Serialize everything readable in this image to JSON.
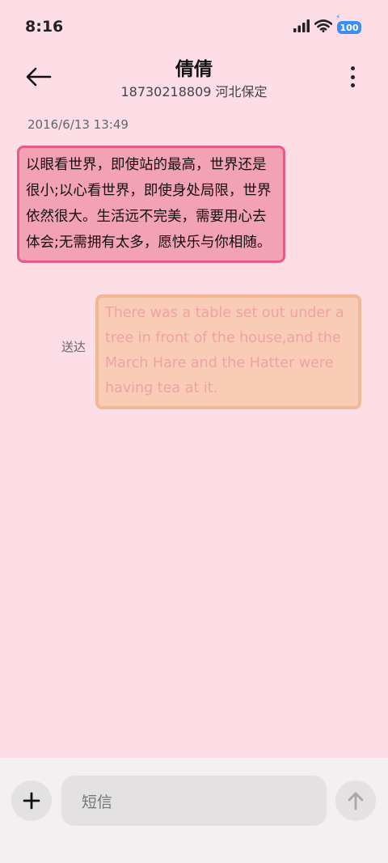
{
  "status_bar": {
    "time": "8:16",
    "battery": "100",
    "icons": [
      "signal-icon",
      "wifi-icon",
      "battery-icon"
    ]
  },
  "header": {
    "name": "倩倩",
    "subtitle": "18730218809 河北保定",
    "back_icon": "back-arrow-icon",
    "more_icon": "more-vertical-icon"
  },
  "conversation": {
    "timestamp": "2016/6/13 13:49",
    "messages": [
      {
        "direction": "incoming",
        "text": "以眼看世界，即使站的最高，世界还是很小;以心看世界，即使身处局限，世界依然很大。生活远不完美，需要用心去体会;无需拥有太多，愿快乐与你相随。"
      },
      {
        "direction": "outgoing",
        "status": "送达",
        "text": "There was a table set out under a tree in front of the house,and the March Hare and the Hatter were having tea at it."
      }
    ]
  },
  "composer": {
    "placeholder": "短信",
    "add_icon": "plus-icon",
    "send_icon": "send-arrow-icon"
  },
  "colors": {
    "background": "#fddde6",
    "incoming_bubble": "#f3a1b5",
    "incoming_border": "#ea5a84",
    "outgoing_bubble": "#f9ccb6",
    "outgoing_border": "#f2b796",
    "outgoing_text": "#f1a0a6",
    "battery": "#3a8ef5"
  }
}
